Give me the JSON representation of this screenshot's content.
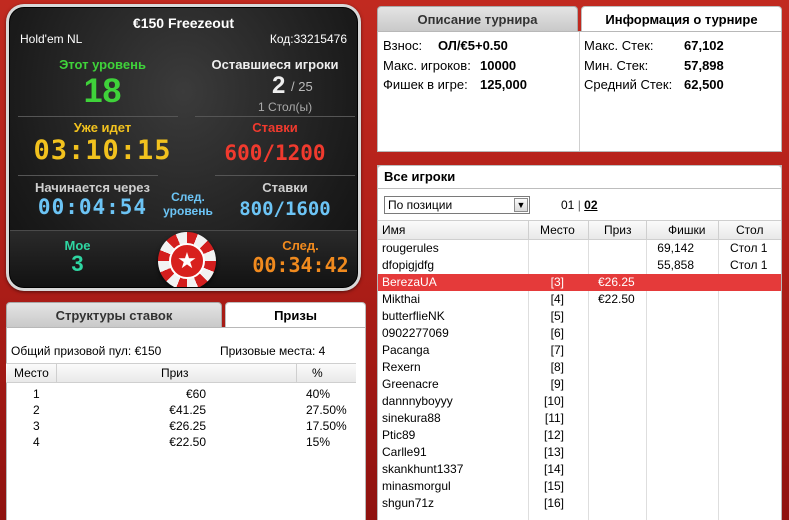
{
  "status": {
    "title": "€150 Freezeout",
    "game": "Hold'em NL",
    "code": "Код:33215476",
    "this_level_label": "Этот уровень",
    "this_level_value": "18",
    "remaining_label": "Оставшиеся игроки",
    "remaining_value": "2",
    "remaining_total": "/ 25",
    "tables": "1 Стол(ы)",
    "elapsed_label": "Уже идет",
    "elapsed_value": "03:10:15",
    "stakes_label": "Ставки",
    "stakes_value": "600/1200",
    "starts_in_label": "Начинается через",
    "starts_in_value": "00:04:54",
    "next_level_label_1": "След.",
    "next_level_label_2": "уровень",
    "next_stakes_label": "Ставки",
    "next_stakes_value": "800/1600",
    "mine_label": "Мое",
    "mine_value": "3",
    "next_label": "След.",
    "next_value": "00:34:42",
    "chip_symbol": "★",
    "colors": {
      "green": "#3fd23a",
      "yellow": "#f2c21e",
      "red": "#f03a2e",
      "blue": "#6cc4f5"
    }
  },
  "tabs_top": {
    "description": "Описание турнира",
    "info": "Информация о турнире"
  },
  "tournament_info": {
    "entry_label": "Взнос:",
    "entry_value": "ОЛ/€5+0.50",
    "max_players_label": "Макс. игроков:",
    "max_players_value": "10000",
    "chips_label": "Фишек в игре:",
    "chips_value": "125,000",
    "max_stack_label": "Макс. Стек:",
    "max_stack_value": "67,102",
    "min_stack_label": "Мин. Стек:",
    "min_stack_value": "57,898",
    "avg_stack_label": "Средний Стек:",
    "avg_stack_value": "62,500"
  },
  "tabs_bottom": {
    "structures": "Структуры ставок",
    "prizes": "Призы"
  },
  "prizes": {
    "pool": "Общий призовой пул: €150",
    "places": "Призовые места: 4",
    "headers": {
      "place": "Место",
      "prize": "Приз",
      "percent": "%"
    },
    "rows": [
      {
        "place": "1",
        "prize": "€60",
        "percent": "40%"
      },
      {
        "place": "2",
        "prize": "€41.25",
        "percent": "27.50%"
      },
      {
        "place": "3",
        "prize": "€26.25",
        "percent": "17.50%"
      },
      {
        "place": "4",
        "prize": "€22.50",
        "percent": "15%"
      }
    ]
  },
  "players": {
    "title": "Все игроки",
    "sort_select": "По позиции",
    "page1": "01",
    "page2": "02",
    "headers": {
      "name": "Имя",
      "place": "Место",
      "prize": "Приз",
      "chips": "Фишки",
      "table": "Стол"
    },
    "rows": [
      {
        "name": "rougerules",
        "place": "",
        "prize": "",
        "chips": "69,142",
        "table": "Стол 1"
      },
      {
        "name": "dfopigjdfg",
        "place": "",
        "prize": "",
        "chips": "55,858",
        "table": "Стол 1"
      },
      {
        "name": "BerezaUA",
        "place": "[3]",
        "prize": "€26.25",
        "chips": "",
        "table": ""
      },
      {
        "name": "Mikthai",
        "place": "[4]",
        "prize": "€22.50",
        "chips": "",
        "table": ""
      },
      {
        "name": "butterflieNK",
        "place": "[5]",
        "prize": "",
        "chips": "",
        "table": ""
      },
      {
        "name": "0902277069",
        "place": "[6]",
        "prize": "",
        "chips": "",
        "table": ""
      },
      {
        "name": "Pacanga",
        "place": "[7]",
        "prize": "",
        "chips": "",
        "table": ""
      },
      {
        "name": "Rexern",
        "place": "[8]",
        "prize": "",
        "chips": "",
        "table": ""
      },
      {
        "name": "Greenacre",
        "place": "[9]",
        "prize": "",
        "chips": "",
        "table": ""
      },
      {
        "name": "dannnyboyyy",
        "place": "[10]",
        "prize": "",
        "chips": "",
        "table": ""
      },
      {
        "name": "sinekura88",
        "place": "[11]",
        "prize": "",
        "chips": "",
        "table": ""
      },
      {
        "name": "Ptic89",
        "place": "[12]",
        "prize": "",
        "chips": "",
        "table": ""
      },
      {
        "name": "Carlle91",
        "place": "[13]",
        "prize": "",
        "chips": "",
        "table": ""
      },
      {
        "name": "skankhunt1337",
        "place": "[14]",
        "prize": "",
        "chips": "",
        "table": ""
      },
      {
        "name": "minasmorgul",
        "place": "[15]",
        "prize": "",
        "chips": "",
        "table": ""
      },
      {
        "name": "shgun71z",
        "place": "[16]",
        "prize": "",
        "chips": "",
        "table": ""
      }
    ],
    "selected_index": 2
  }
}
